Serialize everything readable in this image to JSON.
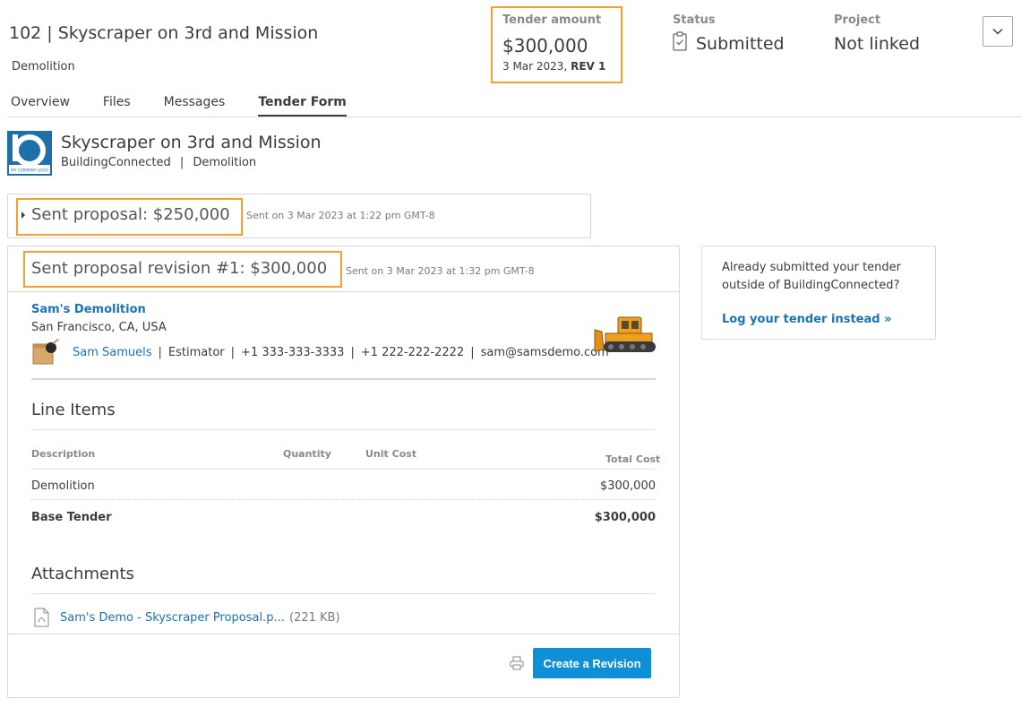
{
  "header": {
    "title": "102 | Skyscraper on 3rd and Mission",
    "subtitle": "Demolition",
    "tender": {
      "label": "Tender amount",
      "amount": "$300,000",
      "date": "3 Mar 2023,",
      "rev": "REV 1"
    },
    "status": {
      "label": "Status",
      "value": "Submitted"
    },
    "project": {
      "label": "Project",
      "value": "Not linked"
    }
  },
  "tabs": [
    {
      "label": "Overview"
    },
    {
      "label": "Files"
    },
    {
      "label": "Messages"
    },
    {
      "label": "Tender Form",
      "active": true
    }
  ],
  "project_info": {
    "logo_text": "MY COMPANY LOGO",
    "name": "Skyscraper on 3rd and Mission",
    "client": "BuildingConnected",
    "sep": "|",
    "trade": "Demolition"
  },
  "proposal_1": {
    "title": "Sent proposal: $250,000",
    "date": "Sent on 3 Mar 2023 at 1:22 pm GMT-8"
  },
  "proposal_2": {
    "title": "Sent proposal revision #1: $300,000",
    "date": "Sent on 3 Mar 2023 at 1:32 pm GMT-8",
    "company": "Sam's Demolition",
    "location": "San Francisco, CA, USA",
    "contact": {
      "name": "Sam Samuels",
      "role": "Estimator",
      "phone1": "+1 333-333-3333",
      "phone2": "+1 222-222-2222",
      "email": "sam@samsdemo.com",
      "sep": "|"
    },
    "line_items": {
      "title": "Line Items",
      "headers": {
        "description": "Description",
        "quantity": "Quantity",
        "unit_cost": "Unit Cost",
        "total_cost": "Total Cost"
      },
      "rows": [
        {
          "description": "Demolition",
          "total": "$300,000"
        }
      ],
      "base": {
        "label": "Base Tender",
        "total": "$300,000"
      }
    },
    "attachments": {
      "title": "Attachments",
      "file": "Sam's Demo - Skyscraper Proposal.p...",
      "size": "(221 KB)"
    },
    "create_button": "Create a Revision"
  },
  "side_card": {
    "text": "Already submitted your tender outside of BuildingConnected?",
    "link": "Log your tender instead »"
  },
  "colors": {
    "accent": "#0f8fd6",
    "link": "#1a73b5",
    "highlight": "#f59f2f"
  }
}
